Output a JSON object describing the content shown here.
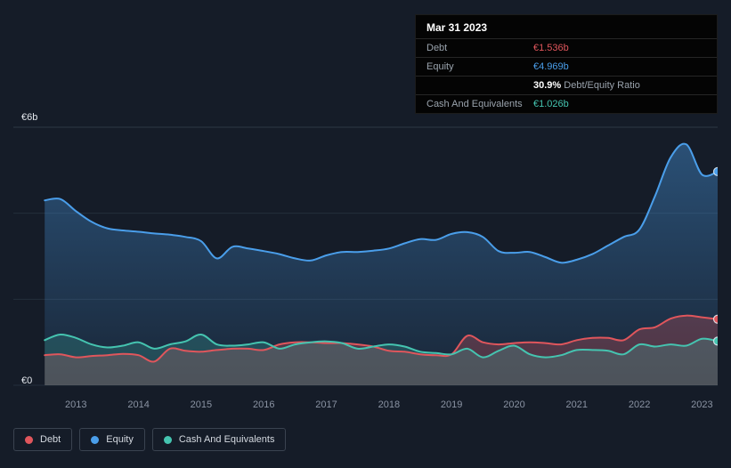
{
  "colors": {
    "background": "#151c28",
    "debt": "#E0565C",
    "equity": "#4A9EEA",
    "cash": "#45C4B0",
    "tooltip_background": "#040404",
    "grid": "#242e3b",
    "axis_text": "#8a93a3"
  },
  "tooltip": {
    "date": "Mar 31 2023",
    "debt_label": "Debt",
    "debt_value": "€1.536b",
    "equity_label": "Equity",
    "equity_value": "€4.969b",
    "ratio_value": "30.9%",
    "ratio_label": "Debt/Equity Ratio",
    "cash_label": "Cash And Equivalents",
    "cash_value": "€1.026b"
  },
  "legend": {
    "items": [
      {
        "label": "Debt",
        "color": "#E0565C"
      },
      {
        "label": "Equity",
        "color": "#4A9EEA"
      },
      {
        "label": "Cash And Equivalents",
        "color": "#45C4B0"
      }
    ]
  },
  "chart_data": {
    "type": "area",
    "title": "",
    "x_range": [
      2012.0,
      2023.25
    ],
    "y_range": [
      0,
      6
    ],
    "y_unit": "€b",
    "y_ticks": [
      {
        "value": 6,
        "label": "€6b"
      },
      {
        "value": 0,
        "label": "€0"
      }
    ],
    "x_ticks": [
      2013,
      2014,
      2015,
      2016,
      2017,
      2018,
      2019,
      2020,
      2021,
      2022,
      2023
    ],
    "gridlines": [
      6,
      4,
      2,
      0
    ],
    "x": [
      2012.5,
      2012.75,
      2013.0,
      2013.25,
      2013.5,
      2013.75,
      2014.0,
      2014.25,
      2014.5,
      2014.75,
      2015.0,
      2015.25,
      2015.5,
      2015.75,
      2016.0,
      2016.25,
      2016.5,
      2016.75,
      2017.0,
      2017.25,
      2017.5,
      2017.75,
      2018.0,
      2018.25,
      2018.5,
      2018.75,
      2019.0,
      2019.25,
      2019.5,
      2019.75,
      2020.0,
      2020.25,
      2020.5,
      2020.75,
      2021.0,
      2021.25,
      2021.5,
      2021.75,
      2022.0,
      2022.25,
      2022.5,
      2022.75,
      2023.0,
      2023.25
    ],
    "series": [
      {
        "name": "Equity",
        "color": "#4A9EEA",
        "fill_opacity": 0.4,
        "gradient": true,
        "values": [
          4.3,
          4.33,
          4.05,
          3.8,
          3.65,
          3.6,
          3.57,
          3.53,
          3.5,
          3.45,
          3.35,
          2.95,
          3.22,
          3.18,
          3.12,
          3.05,
          2.95,
          2.9,
          3.02,
          3.1,
          3.1,
          3.13,
          3.18,
          3.3,
          3.4,
          3.38,
          3.52,
          3.56,
          3.45,
          3.12,
          3.08,
          3.1,
          2.98,
          2.85,
          2.92,
          3.05,
          3.25,
          3.45,
          3.62,
          4.4,
          5.3,
          5.6,
          4.9,
          4.969
        ]
      },
      {
        "name": "Debt",
        "color": "#E0565C",
        "fill_opacity": 0.28,
        "gradient": false,
        "values": [
          0.7,
          0.72,
          0.65,
          0.68,
          0.7,
          0.73,
          0.7,
          0.55,
          0.85,
          0.8,
          0.78,
          0.82,
          0.85,
          0.85,
          0.82,
          0.95,
          1.0,
          1.0,
          0.98,
          0.98,
          0.95,
          0.9,
          0.8,
          0.78,
          0.72,
          0.7,
          0.72,
          1.15,
          1.0,
          0.95,
          0.98,
          1.0,
          0.98,
          0.95,
          1.05,
          1.1,
          1.1,
          1.05,
          1.3,
          1.35,
          1.55,
          1.62,
          1.58,
          1.536
        ]
      },
      {
        "name": "Cash And Equivalents",
        "color": "#45C4B0",
        "fill_opacity": 0.22,
        "gradient": false,
        "values": [
          1.05,
          1.18,
          1.1,
          0.95,
          0.88,
          0.92,
          1.0,
          0.85,
          0.95,
          1.02,
          1.18,
          0.95,
          0.92,
          0.95,
          1.0,
          0.85,
          0.95,
          1.0,
          1.02,
          0.98,
          0.85,
          0.9,
          0.95,
          0.9,
          0.78,
          0.75,
          0.72,
          0.85,
          0.65,
          0.8,
          0.92,
          0.72,
          0.65,
          0.7,
          0.82,
          0.82,
          0.8,
          0.72,
          0.95,
          0.9,
          0.95,
          0.92,
          1.08,
          1.026
        ]
      }
    ]
  }
}
